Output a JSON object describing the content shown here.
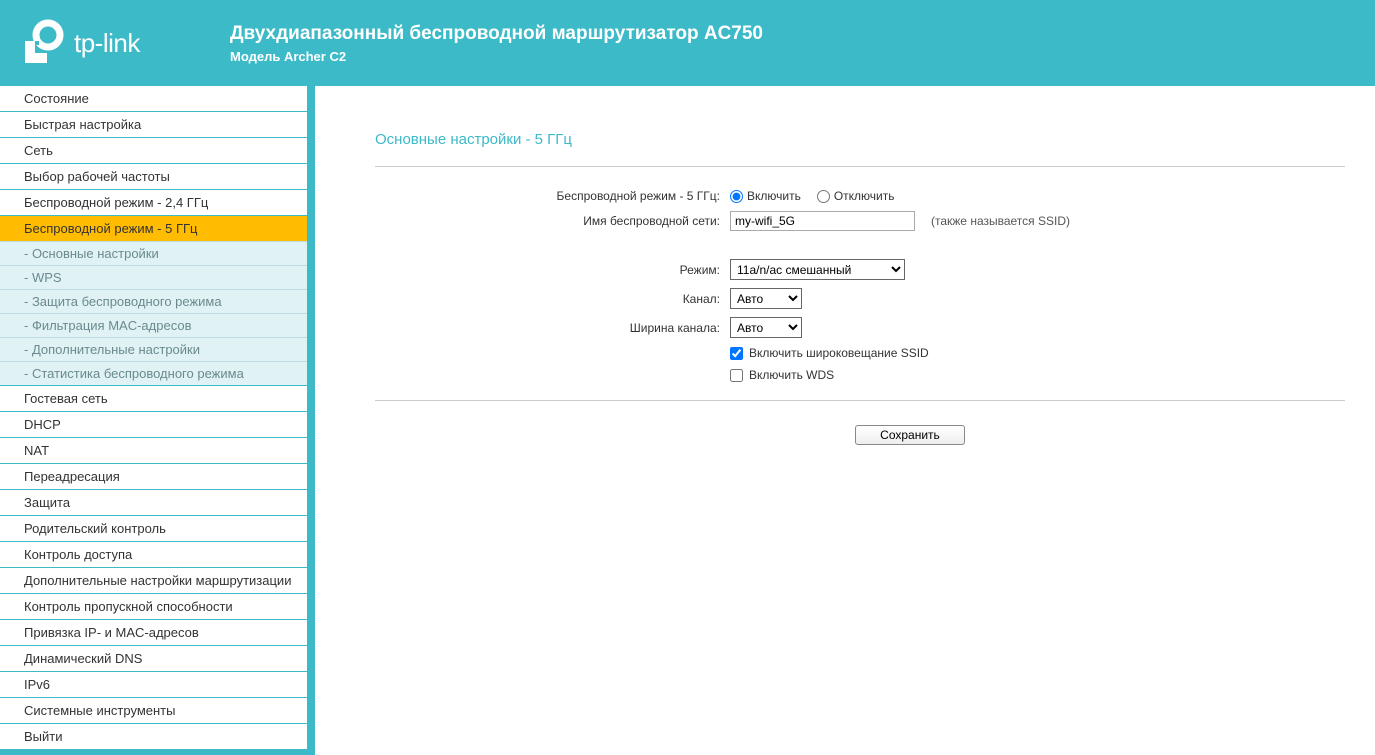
{
  "header": {
    "brand": "tp-link",
    "title": "Двухдиапазонный беспроводной маршрутизатор AC750",
    "model": "Модель Archer C2"
  },
  "sidebar": {
    "items": [
      {
        "label": "Состояние"
      },
      {
        "label": "Быстрая настройка"
      },
      {
        "label": "Сеть"
      },
      {
        "label": "Выбор рабочей частоты"
      },
      {
        "label": "Беспроводной режим - 2,4 ГГц"
      },
      {
        "label": "Беспроводной режим - 5 ГГц",
        "selected": true,
        "children": [
          {
            "label": "- Основные настройки"
          },
          {
            "label": "- WPS"
          },
          {
            "label": "- Защита беспроводного режима"
          },
          {
            "label": "- Фильтрация MAC-адресов"
          },
          {
            "label": "- Дополнительные настройки"
          },
          {
            "label": "- Статистика беспроводного режима"
          }
        ]
      },
      {
        "label": "Гостевая сеть"
      },
      {
        "label": "DHCP"
      },
      {
        "label": "NAT"
      },
      {
        "label": "Переадресация"
      },
      {
        "label": "Защита"
      },
      {
        "label": "Родительский контроль"
      },
      {
        "label": "Контроль доступа"
      },
      {
        "label": "Дополнительные настройки маршрутизации"
      },
      {
        "label": "Контроль пропускной способности"
      },
      {
        "label": "Привязка IP- и MAC-адресов"
      },
      {
        "label": "Динамический DNS"
      },
      {
        "label": "IPv6"
      },
      {
        "label": "Системные инструменты"
      },
      {
        "label": "Выйти"
      }
    ]
  },
  "page": {
    "title": "Основные настройки - 5 ГГц",
    "labels": {
      "wireless": "Беспроводной режим - 5 ГГц:",
      "ssid": "Имя беспроводной сети:",
      "mode": "Режим:",
      "channel": "Канал:",
      "width": "Ширина канала:",
      "ssid_note": "(также называется SSID)",
      "enable": "Включить",
      "disable": "Отключить",
      "broadcast": "Включить широковещание SSID",
      "wds": "Включить WDS"
    },
    "values": {
      "ssid": "my-wifi_5G",
      "mode": "11a/n/ac смешанный",
      "channel": "Авто",
      "width": "Авто"
    },
    "save": "Сохранить"
  }
}
